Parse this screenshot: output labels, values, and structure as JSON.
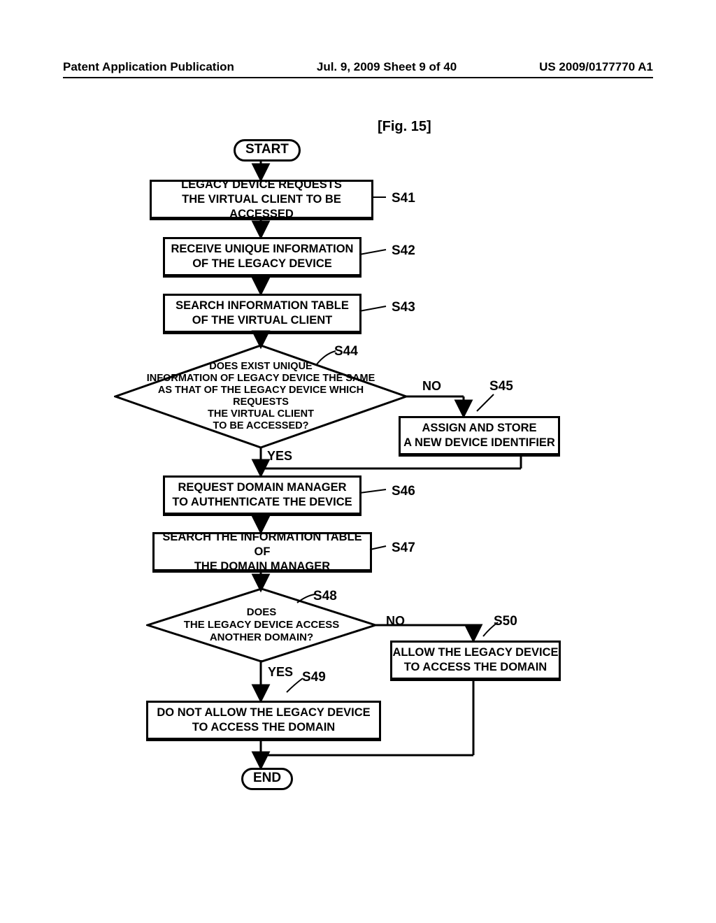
{
  "header": {
    "left": "Patent Application Publication",
    "center": "Jul. 9, 2009  Sheet 9 of 40",
    "right": "US 2009/0177770 A1"
  },
  "figure_label": "[Fig. 15]",
  "terminators": {
    "start": "START",
    "end": "END"
  },
  "steps": {
    "s41": "LEGACY DEVICE REQUESTS\nTHE VIRTUAL CLIENT TO BE ACCESSED",
    "s42": "RECEIVE UNIQUE INFORMATION\nOF THE LEGACY DEVICE",
    "s43": "SEARCH INFORMATION TABLE\nOF THE VIRTUAL CLIENT",
    "s44": "DOES EXIST UNIQUE\nINFORMATION OF LEGACY DEVICE THE SAME\nAS THAT OF THE LEGACY DEVICE WHICH REQUESTS\nTHE VIRTUAL CLIENT\nTO BE ACCESSED?",
    "s45": "ASSIGN AND STORE\nA NEW DEVICE IDENTIFIER",
    "s46": "REQUEST DOMAIN MANAGER\nTO AUTHENTICATE THE DEVICE",
    "s47": "SEARCH THE INFORMATION TABLE OF\nTHE DOMAIN MANAGER",
    "s48": "DOES\nTHE LEGACY DEVICE ACCESS\nANOTHER DOMAIN?",
    "s49": "DO NOT ALLOW THE LEGACY DEVICE\nTO ACCESS THE DOMAIN",
    "s50": "ALLOW THE LEGACY DEVICE\nTO ACCESS THE DOMAIN"
  },
  "labels": {
    "s41": "S41",
    "s42": "S42",
    "s43": "S43",
    "s44": "S44",
    "s45": "S45",
    "s46": "S46",
    "s47": "S47",
    "s48": "S48",
    "s49": "S49",
    "s50": "S50"
  },
  "answers": {
    "yes": "YES",
    "no": "NO"
  }
}
